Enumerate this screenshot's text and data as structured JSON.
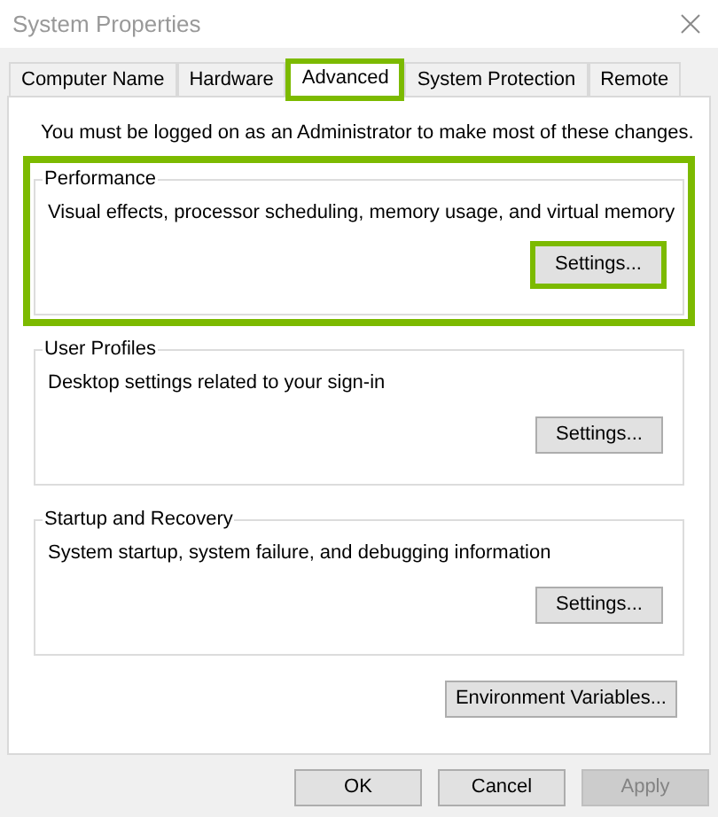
{
  "window": {
    "title": "System Properties"
  },
  "tabs": [
    {
      "label": "Computer Name",
      "selected": false,
      "highlighted": false
    },
    {
      "label": "Hardware",
      "selected": false,
      "highlighted": false
    },
    {
      "label": "Advanced",
      "selected": true,
      "highlighted": true
    },
    {
      "label": "System Protection",
      "selected": false,
      "highlighted": false
    },
    {
      "label": "Remote",
      "selected": false,
      "highlighted": false
    }
  ],
  "notice": "You must be logged on as an Administrator to make most of these changes.",
  "groups": [
    {
      "title": "Performance",
      "description": "Visual effects, processor scheduling, memory usage, and virtual memory",
      "highlighted": true,
      "button": {
        "label": "Settings...",
        "highlighted": true
      }
    },
    {
      "title": "User Profiles",
      "description": "Desktop settings related to your sign-in",
      "highlighted": false,
      "button": {
        "label": "Settings...",
        "highlighted": false
      }
    },
    {
      "title": "Startup and Recovery",
      "description": "System startup, system failure, and debugging information",
      "highlighted": false,
      "button": {
        "label": "Settings...",
        "highlighted": false
      }
    }
  ],
  "environment_button": {
    "label": "Environment Variables..."
  },
  "buttons": [
    {
      "label": "OK",
      "disabled": false
    },
    {
      "label": "Cancel",
      "disabled": false
    },
    {
      "label": "Apply",
      "disabled": true
    }
  ]
}
